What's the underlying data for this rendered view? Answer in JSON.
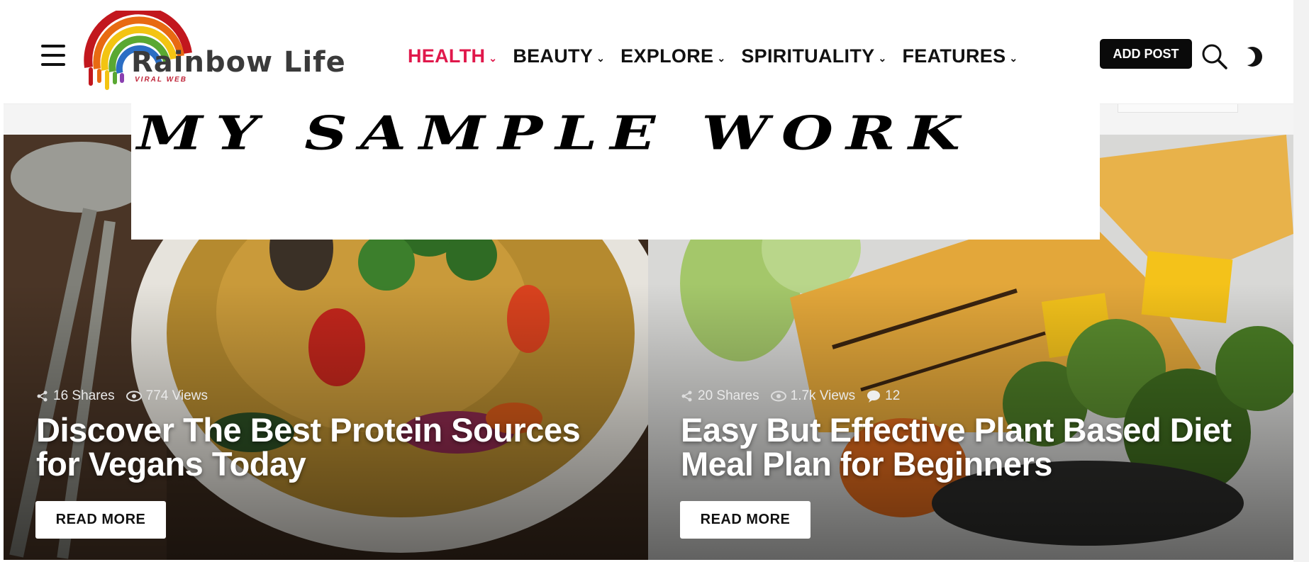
{
  "header": {
    "logo": {
      "name": "Rainbow Life",
      "tagline": "VIRAL WEB"
    },
    "nav": [
      {
        "label": "HEALTH",
        "active": true
      },
      {
        "label": "BEAUTY",
        "active": false
      },
      {
        "label": "EXPLORE",
        "active": false
      },
      {
        "label": "SPIRITUALITY",
        "active": false
      },
      {
        "label": "FEATURES",
        "active": false
      }
    ],
    "add_post_label": "ADD POST",
    "icons": {
      "menu": "hamburger-icon",
      "search": "search-icon",
      "theme": "moon-icon"
    },
    "colors": {
      "accent": "#e0184b",
      "button": "#0a0a0a"
    }
  },
  "overlay": {
    "text": "MY SAMPLE WORK"
  },
  "cards": [
    {
      "shares": "16 Shares",
      "views": "774 Views",
      "title": "Discover The Best Protein Sources for Vegans Today",
      "read_more": "READ MORE"
    },
    {
      "shares": "20 Shares",
      "views": "1.7k Views",
      "comments": "12",
      "title": "Easy But Effective Plant Based Diet Meal Plan for Beginners",
      "read_more": "READ MORE"
    }
  ]
}
